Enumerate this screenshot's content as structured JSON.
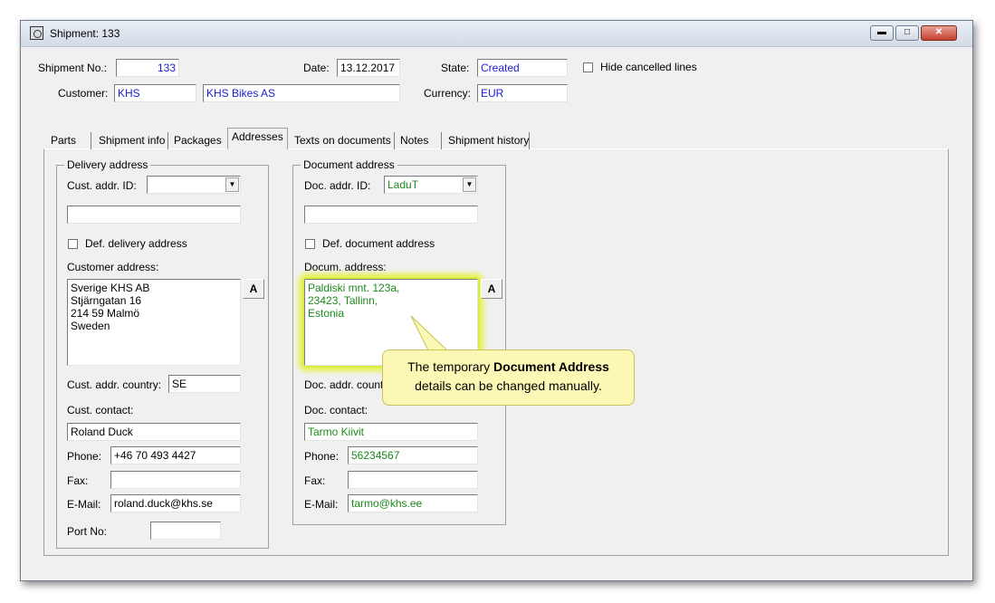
{
  "window": {
    "title": "Shipment: 133"
  },
  "header": {
    "shipment_no_label": "Shipment No.:",
    "shipment_no": "133",
    "date_label": "Date:",
    "date": "13.12.2017",
    "state_label": "State:",
    "state": "Created",
    "hide_cancelled_label": "Hide cancelled lines",
    "customer_label": "Customer:",
    "customer_code": "KHS",
    "customer_name": "KHS Bikes AS",
    "currency_label": "Currency:",
    "currency": "EUR"
  },
  "tabs": [
    "Parts",
    "Shipment info",
    "Packages",
    "Addresses",
    "Texts on documents",
    "Notes",
    "Shipment history"
  ],
  "active_tab": "Addresses",
  "delivery": {
    "group_title": "Delivery address",
    "cust_addr_id_label": "Cust. addr. ID:",
    "cust_addr_id": "",
    "extra_field": "",
    "def_delivery_label": "Def. delivery address",
    "customer_address_label": "Customer address:",
    "address_lines": [
      "Sverige KHS AB",
      "Stjärngatan 16",
      "214 59 Malmö",
      "Sweden"
    ],
    "a_button": "A",
    "country_label": "Cust. addr. country:",
    "country": "SE",
    "contact_label": "Cust. contact:",
    "contact": "Roland Duck",
    "phone_label": "Phone:",
    "phone": "+46 70 493 4427",
    "fax_label": "Fax:",
    "fax": "",
    "email_label": "E-Mail:",
    "email": "roland.duck@khs.se",
    "port_label": "Port No:",
    "port": ""
  },
  "document": {
    "group_title": "Document address",
    "doc_addr_id_label": "Doc. addr. ID:",
    "doc_addr_id": "LaduT",
    "extra_field": "",
    "def_document_label": "Def. document address",
    "docum_address_label": "Docum. address:",
    "address_lines": [
      "Paldiski mnt. 123a,",
      "23423, Tallinn,",
      "Estonia"
    ],
    "a_button": "A",
    "country_label": "Doc. addr. count",
    "contact_label": "Doc. contact:",
    "contact": "Tarmo Kiivit",
    "phone_label": "Phone:",
    "phone": "56234567",
    "fax_label": "Fax:",
    "fax": "",
    "email_label": "E-Mail:",
    "email": "tarmo@khs.ee"
  },
  "callout": {
    "text_before": "The temporary ",
    "text_bold": "Document Address",
    "text_after": "details can be changed manually."
  },
  "colors": {
    "value_blue": "#1b1bd6",
    "value_green": "#1a8a1a",
    "callout_bg": "#fbf7b4",
    "highlight": "#d9ef3f"
  }
}
